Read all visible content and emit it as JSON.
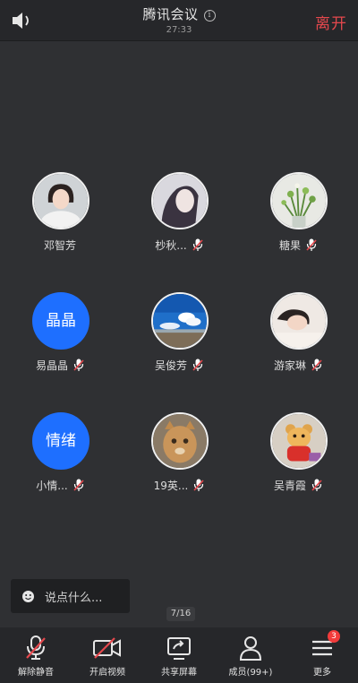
{
  "header": {
    "title": "腾讯会议",
    "timer": "27:33",
    "leave_label": "离开",
    "info_glyph": "i"
  },
  "participants": [
    {
      "name": "邓智芳",
      "muted": false,
      "avatar": "photo-woman-portrait"
    },
    {
      "name": "杪秋...",
      "muted": true,
      "avatar": "illustration-woman"
    },
    {
      "name": "糖果",
      "muted": true,
      "avatar": "photo-flowers"
    },
    {
      "name": "易晶晶",
      "muted": true,
      "avatar_text": "晶晶"
    },
    {
      "name": "吴俊芳",
      "muted": true,
      "avatar": "photo-sky"
    },
    {
      "name": "游家琳",
      "muted": true,
      "avatar": "photo-woman-lying"
    },
    {
      "name": "小情...",
      "muted": true,
      "avatar_text": "情绪"
    },
    {
      "name": "19英...",
      "muted": true,
      "avatar": "photo-cat"
    },
    {
      "name": "吴青霞",
      "muted": true,
      "avatar": "photo-bear-toy"
    }
  ],
  "chat": {
    "placeholder": "说点什么..."
  },
  "pager": "7/16",
  "toolbar": {
    "unmute": "解除静音",
    "video": "开启视频",
    "share": "共享屏幕",
    "members": "成员(99+)",
    "more": "更多",
    "more_badge": "3"
  },
  "colors": {
    "background": "#2f3033",
    "bar": "#26272a",
    "leave": "#e5484d",
    "avatar_blue": "#1e6fff",
    "muted_red": "#e5484d",
    "badge": "#f23b3b"
  }
}
